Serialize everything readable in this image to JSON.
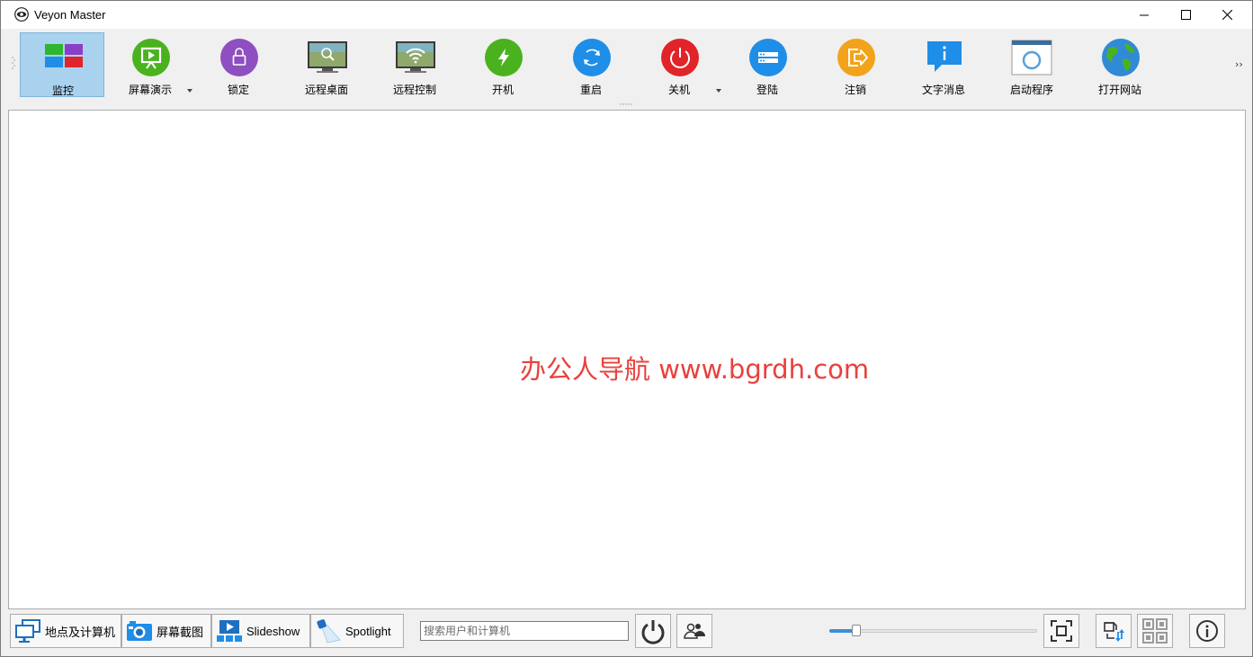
{
  "window": {
    "title": "Veyon Master"
  },
  "toolbar": {
    "items": [
      {
        "label": "监控",
        "icon": "monitor-grid-icon",
        "active": true
      },
      {
        "label": "屏幕演示",
        "icon": "presentation-icon",
        "dropdown": true
      },
      {
        "label": "锁定",
        "icon": "lock-icon"
      },
      {
        "label": "远程桌面",
        "icon": "remote-view-icon"
      },
      {
        "label": "远程控制",
        "icon": "remote-control-icon"
      },
      {
        "label": "开机",
        "icon": "power-on-icon"
      },
      {
        "label": "重启",
        "icon": "reboot-icon"
      },
      {
        "label": "关机",
        "icon": "power-off-icon",
        "dropdown": true
      },
      {
        "label": "登陆",
        "icon": "login-icon"
      },
      {
        "label": "注销",
        "icon": "logout-icon"
      },
      {
        "label": "文字消息",
        "icon": "text-message-icon"
      },
      {
        "label": "启动程序",
        "icon": "run-program-icon"
      },
      {
        "label": "打开网站",
        "icon": "open-website-icon"
      }
    ],
    "more": "››"
  },
  "main": {
    "watermark": "办公人导航  www.bgrdh.com"
  },
  "statusbar": {
    "buttons": [
      {
        "label": "地点及计算机",
        "icon": "computers-icon"
      },
      {
        "label": "屏幕截图",
        "icon": "screenshot-camera-icon"
      },
      {
        "label": "Slideshow",
        "icon": "slideshow-icon"
      },
      {
        "label": "Spotlight",
        "icon": "spotlight-icon"
      }
    ],
    "search_placeholder": "搜索用户和计算机",
    "zoom_level": 0.13
  },
  "colors": {
    "active_bg": "#a9d2ef",
    "watermark": "#e8413d",
    "slider_fill": "#3c8fd9"
  }
}
